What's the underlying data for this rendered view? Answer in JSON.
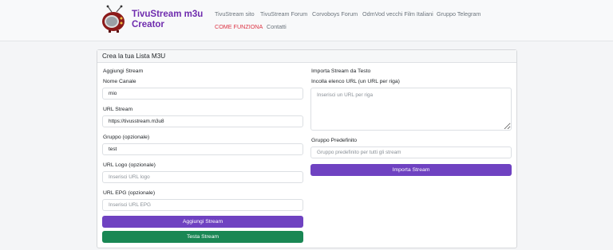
{
  "brand": {
    "line1": "TivuStream m3u",
    "line2": "Creator",
    "logo_icon": "retro-tv-icon",
    "accent_color": "#6f2cae"
  },
  "nav": {
    "items": [
      "TivuStream sito",
      "TivuStream Forum",
      "Corvoboys Forum",
      "OdmVod vecchi Film Italiani",
      "Gruppo Telegram"
    ],
    "row2": [
      "COME FUNZIONA",
      "Contatti"
    ],
    "active_color": "#dc3545"
  },
  "card": {
    "title": "Crea la tua Lista M3U",
    "left": {
      "section_title": "Aggiungi Stream",
      "fields": [
        {
          "label": "Nome Canale",
          "value": "mio",
          "placeholder": ""
        },
        {
          "label": "URL Stream",
          "value": "https://tivusstream.m3u8",
          "placeholder": ""
        },
        {
          "label": "Gruppo (opzionale)",
          "value": "test",
          "placeholder": ""
        },
        {
          "label": "URL Logo (opzionale)",
          "value": "",
          "placeholder": "Inserisci URL logo"
        },
        {
          "label": "URL EPG (opzionale)",
          "value": "",
          "placeholder": "Inserisci URL EPG"
        }
      ],
      "add_button": "Aggiungi Stream",
      "test_button": "Testa Stream"
    },
    "right": {
      "section_title": "Importa Stream da Testo",
      "urls_label": "Incolla elenco URL (un URL per riga)",
      "urls_placeholder": "Inserisci un URL per riga",
      "group_label": "Gruppo Predefinito",
      "group_placeholder": "Gruppo predefinito per tutti gli stream",
      "import_button": "Importa Stream"
    }
  },
  "colors": {
    "purple_button": "#6f42c1",
    "green_button": "#198754"
  }
}
